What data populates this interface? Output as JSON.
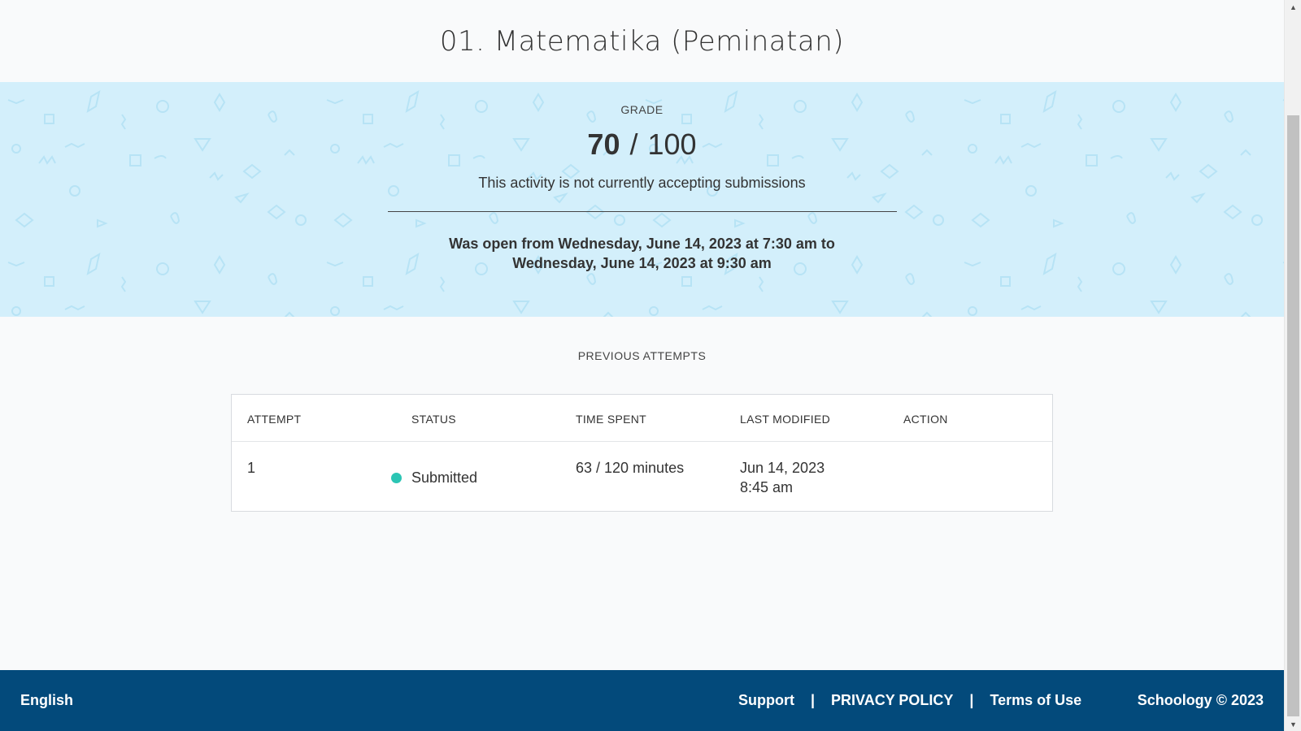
{
  "page": {
    "title": "01. Matematika (Peminatan)"
  },
  "grade": {
    "label": "GRADE",
    "score": "70",
    "separator": "/",
    "max": "100",
    "status_text": "This activity is not currently accepting submissions",
    "open_line1": "Was open from Wednesday, June 14, 2023 at 7:30 am to",
    "open_line2": "Wednesday, June 14, 2023 at 9:30 am"
  },
  "attempts": {
    "label": "PREVIOUS ATTEMPTS",
    "columns": [
      "ATTEMPT",
      "STATUS",
      "TIME SPENT",
      "LAST MODIFIED",
      "ACTION"
    ],
    "rows": [
      {
        "attempt": "1",
        "status": "Submitted",
        "time_spent": "63 / 120 minutes",
        "last_modified_date": "Jun 14, 2023",
        "last_modified_time": "8:45 am",
        "action": ""
      }
    ]
  },
  "footer": {
    "language": "English",
    "support": "Support",
    "privacy": "PRIVACY POLICY",
    "terms": "Terms of Use",
    "divider": "|",
    "copyright": "Schoology © 2023"
  },
  "colors": {
    "hero_bg": "#d3effb",
    "footer_bg": "#034a7b",
    "status_submitted": "#2bc5b4"
  },
  "icons": {
    "status": "status-dot-icon",
    "scroll_up": "scroll-up-arrow-icon",
    "scroll_down": "scroll-down-arrow-icon"
  }
}
